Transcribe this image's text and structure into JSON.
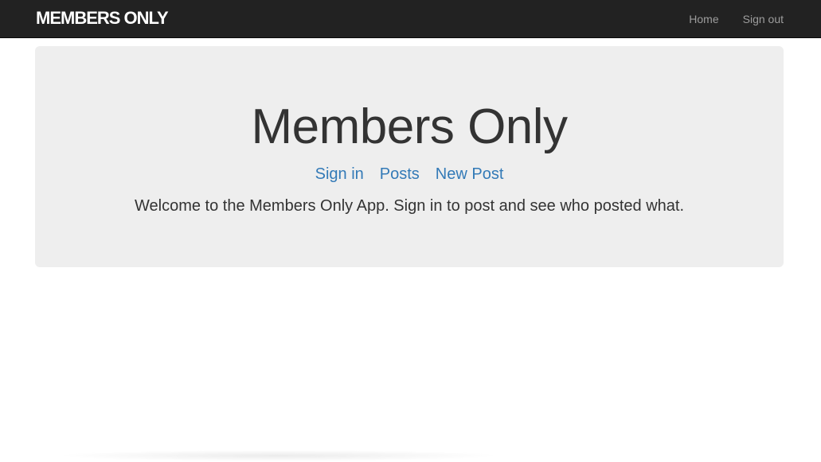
{
  "navbar": {
    "brand": "MEMBERS ONLY",
    "links": [
      {
        "label": "Home"
      },
      {
        "label": "Sign out"
      }
    ]
  },
  "jumbotron": {
    "title": "Members Only",
    "links": [
      {
        "label": "Sign in"
      },
      {
        "label": "Posts"
      },
      {
        "label": "New Post"
      }
    ],
    "welcome": "Welcome to the Members Only App. Sign in to post and see who posted what."
  },
  "colors": {
    "navbar_bg": "#222222",
    "link": "#337ab7",
    "jumbotron_bg": "#eeeeee",
    "text": "#333333"
  }
}
